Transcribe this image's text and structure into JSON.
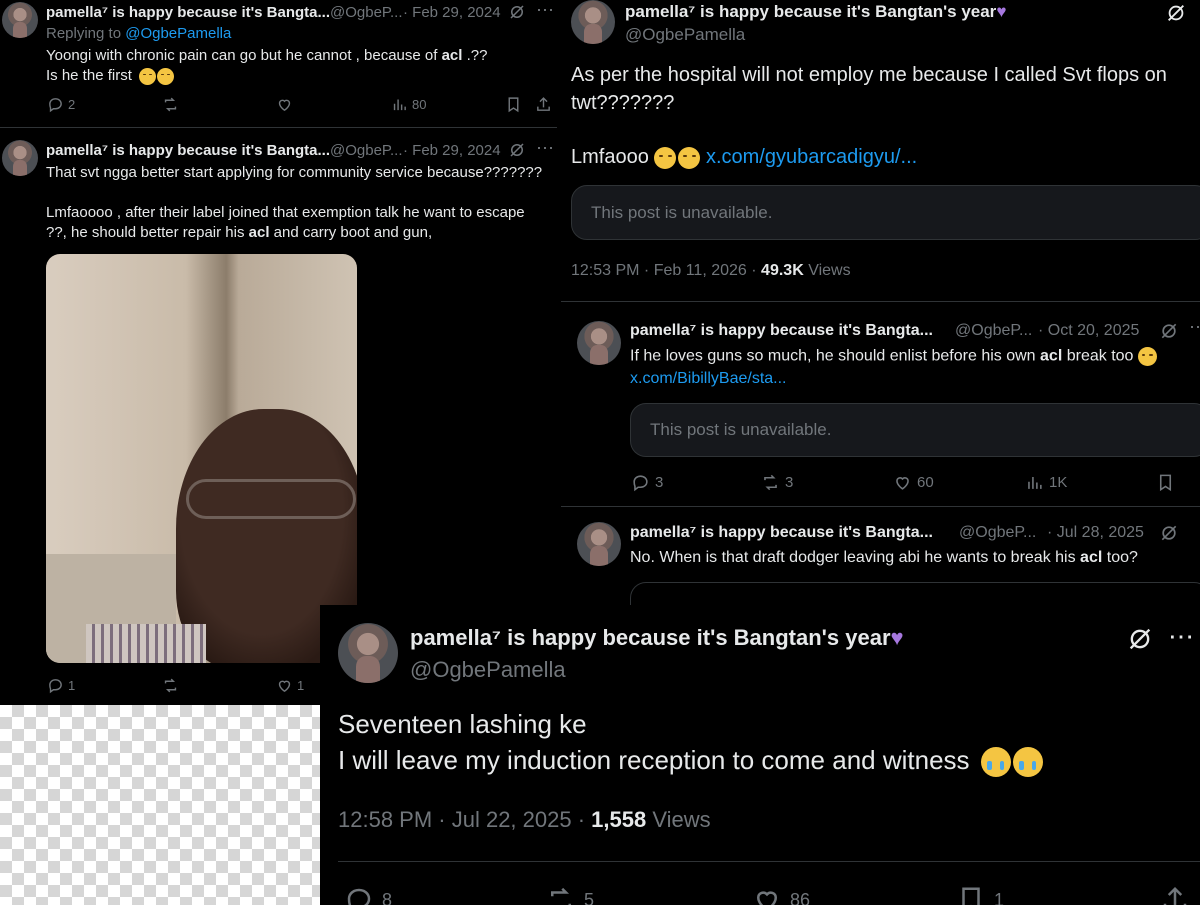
{
  "tweet_a": {
    "name": "pamella⁷ is happy because it's Bangta...",
    "handle": "@OgbeP...",
    "date": "· Feb 29, 2024",
    "replying_prefix": "Replying to",
    "replying_handle": "@OgbePamella",
    "line1_pre": "Yoongi with chronic pain can go but he cannot , because of",
    "line1_bold": "acl",
    "line1_post": ".??",
    "line2": "Is he the first",
    "replies": "2",
    "retweets": "",
    "likes": "",
    "views": "80"
  },
  "tweet_b": {
    "name": "pamella⁷ is happy because it's Bangta...",
    "handle": "@OgbeP...",
    "date": "· Feb 29, 2024",
    "line1": "That svt ngga better start applying for community service because???????",
    "line2": "Lmfaoooo , after their label joined that exemption talk he want to escape",
    "line3_pre": "??, he should better repair his",
    "line3_bold": "acl",
    "line3_post": "and carry boot and gun,",
    "replies": "1",
    "likes": "1"
  },
  "tweet_c": {
    "name": "pamella⁷ is happy because it's Bangtan's year",
    "handle": "@OgbePamella",
    "text1": "As per the hospital will not employ me because I called Svt flops on",
    "text2": "twt???????",
    "text3": "Lmfaooo",
    "link": "x.com/gyubarcadigyu/...",
    "unavailable": "This post is unavailable.",
    "time": "12:53 PM · Feb 11, 2026 ·",
    "views_count": "49.3K",
    "views_label": "Views"
  },
  "tweet_d": {
    "name": "pamella⁷ is happy because it's Bangta...",
    "handle": "@OgbeP...",
    "date": "· Oct 20, 2025",
    "text_pre": "If he loves guns so much, he should enlist before his own",
    "text_bold": "acl",
    "text_post": "break too",
    "link": "x.com/BibillyBae/sta...",
    "unavailable": "This post is unavailable.",
    "replies": "3",
    "retweets": "3",
    "likes": "60",
    "views": "1K"
  },
  "tweet_e": {
    "name": "pamella⁷ is happy because it's Bangta...",
    "handle": "@OgbeP...",
    "date": "· Jul 28, 2025",
    "text_pre": "No. When is that draft dodger leaving abi he wants to break his",
    "text_bold": "acl",
    "text_post": "too?"
  },
  "tweet_f": {
    "name": "pamella⁷ is happy because it's Bangtan's year",
    "handle": "@OgbePamella",
    "line1": "Seventeen lashing ke",
    "line2": "I will leave my induction reception to come and witness",
    "time": "12:58 PM · Jul 22, 2025 ·",
    "views_count": "1,558",
    "views_label": "Views",
    "replies": "8",
    "retweets": "5",
    "likes": "86",
    "bookmarks": "1"
  },
  "icons": {
    "grok": "grok-icon",
    "more": "more-icon",
    "reply": "reply-icon",
    "retweet": "retweet-icon",
    "like": "heart-icon",
    "views": "views-icon",
    "bookmark": "bookmark-icon",
    "share": "share-icon"
  },
  "colors": {
    "link": "#1d9bf0",
    "muted": "#71767b",
    "text": "#e7e9ea",
    "heart_emoji": "#a678df"
  }
}
